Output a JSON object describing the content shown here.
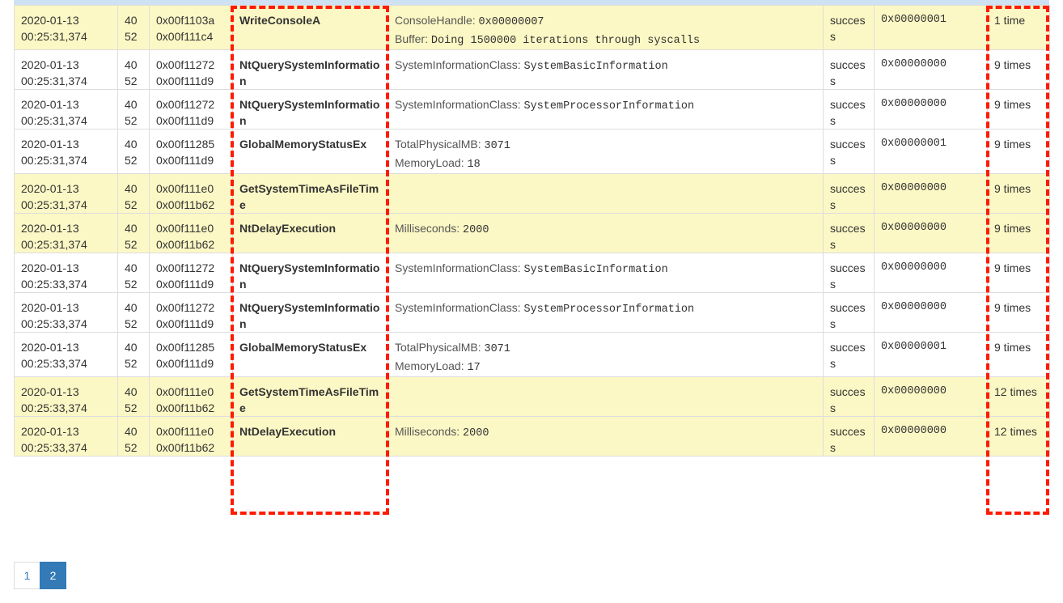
{
  "rows": [
    {
      "date": "2020-01-13",
      "time": "00:25:31,374",
      "tid_a": "40",
      "tid_b": "52",
      "caller": "0x00f1103a",
      "parent": "0x00f111c4",
      "api": "WriteConsoleA",
      "args": [
        {
          "name": "ConsoleHandle: ",
          "value": "0x00000007"
        },
        {
          "name": "Buffer: ",
          "value": "Doing 1500000 iterations through syscalls"
        }
      ],
      "status": "success",
      "ret": "0x00000001",
      "repeat": "1 time",
      "hl": true
    },
    {
      "date": "2020-01-13",
      "time": "00:25:31,374",
      "tid_a": "40",
      "tid_b": "52",
      "caller": "0x00f11272",
      "parent": "0x00f111d9",
      "api": "NtQuerySystemInformation",
      "args": [
        {
          "name": "SystemInformationClass: ",
          "value": "SystemBasicInformation"
        }
      ],
      "status": "success",
      "ret": "0x00000000",
      "repeat": "9 times",
      "hl": false
    },
    {
      "date": "2020-01-13",
      "time": "00:25:31,374",
      "tid_a": "40",
      "tid_b": "52",
      "caller": "0x00f11272",
      "parent": "0x00f111d9",
      "api": "NtQuerySystemInformation",
      "args": [
        {
          "name": "SystemInformationClass: ",
          "value": "SystemProcessorInformation"
        }
      ],
      "status": "success",
      "ret": "0x00000000",
      "repeat": "9 times",
      "hl": false
    },
    {
      "date": "2020-01-13",
      "time": "00:25:31,374",
      "tid_a": "40",
      "tid_b": "52",
      "caller": "0x00f11285",
      "parent": "0x00f111d9",
      "api": "GlobalMemoryStatusEx",
      "args": [
        {
          "name": "TotalPhysicalMB: ",
          "value": "3071"
        },
        {
          "name": "MemoryLoad: ",
          "value": "18"
        }
      ],
      "status": "success",
      "ret": "0x00000001",
      "repeat": "9 times",
      "hl": false
    },
    {
      "date": "2020-01-13",
      "time": "00:25:31,374",
      "tid_a": "40",
      "tid_b": "52",
      "caller": "0x00f111e0",
      "parent": "0x00f11b62",
      "api": "GetSystemTimeAsFileTime",
      "args": [],
      "status": "success",
      "ret": "0x00000000",
      "repeat": "9 times",
      "hl": true
    },
    {
      "date": "2020-01-13",
      "time": "00:25:31,374",
      "tid_a": "40",
      "tid_b": "52",
      "caller": "0x00f111e0",
      "parent": "0x00f11b62",
      "api": "NtDelayExecution",
      "args": [
        {
          "name": "Milliseconds: ",
          "value": "2000"
        }
      ],
      "status": "success",
      "ret": "0x00000000",
      "repeat": "9 times",
      "hl": true
    },
    {
      "date": "2020-01-13",
      "time": "00:25:33,374",
      "tid_a": "40",
      "tid_b": "52",
      "caller": "0x00f11272",
      "parent": "0x00f111d9",
      "api": "NtQuerySystemInformation",
      "args": [
        {
          "name": "SystemInformationClass: ",
          "value": "SystemBasicInformation"
        }
      ],
      "status": "success",
      "ret": "0x00000000",
      "repeat": "9 times",
      "hl": false
    },
    {
      "date": "2020-01-13",
      "time": "00:25:33,374",
      "tid_a": "40",
      "tid_b": "52",
      "caller": "0x00f11272",
      "parent": "0x00f111d9",
      "api": "NtQuerySystemInformation",
      "args": [
        {
          "name": "SystemInformationClass: ",
          "value": "SystemProcessorInformation"
        }
      ],
      "status": "success",
      "ret": "0x00000000",
      "repeat": "9 times",
      "hl": false
    },
    {
      "date": "2020-01-13",
      "time": "00:25:33,374",
      "tid_a": "40",
      "tid_b": "52",
      "caller": "0x00f11285",
      "parent": "0x00f111d9",
      "api": "GlobalMemoryStatusEx",
      "args": [
        {
          "name": "TotalPhysicalMB: ",
          "value": "3071"
        },
        {
          "name": "MemoryLoad: ",
          "value": "17"
        }
      ],
      "status": "success",
      "ret": "0x00000001",
      "repeat": "9 times",
      "hl": false
    },
    {
      "date": "2020-01-13",
      "time": "00:25:33,374",
      "tid_a": "40",
      "tid_b": "52",
      "caller": "0x00f111e0",
      "parent": "0x00f11b62",
      "api": "GetSystemTimeAsFileTime",
      "args": [],
      "status": "success",
      "ret": "0x00000000",
      "repeat": "12 times",
      "hl": true
    },
    {
      "date": "2020-01-13",
      "time": "00:25:33,374",
      "tid_a": "40",
      "tid_b": "52",
      "caller": "0x00f111e0",
      "parent": "0x00f11b62",
      "api": "NtDelayExecution",
      "args": [
        {
          "name": "Milliseconds: ",
          "value": "2000"
        }
      ],
      "status": "success",
      "ret": "0x00000000",
      "repeat": "12 times",
      "hl": true
    }
  ],
  "pagination": {
    "pages": [
      "1",
      "2"
    ],
    "active": "2"
  },
  "colors": {
    "highlight_row": "#fcf8c5",
    "annotation_dash": "#ff1a00",
    "page_active": "#337ab7"
  }
}
